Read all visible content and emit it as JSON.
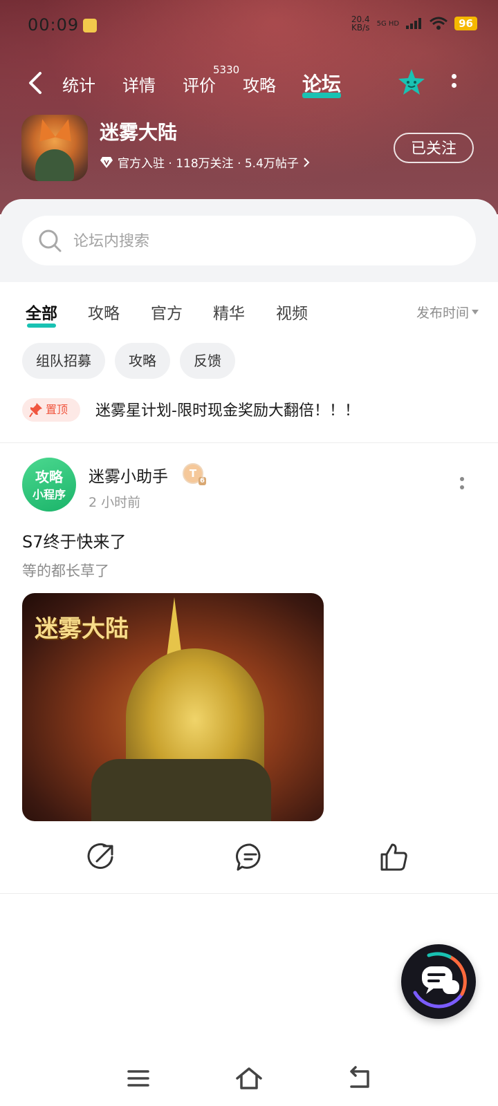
{
  "status_bar": {
    "time": "00:09",
    "net_speed_value": "20.4",
    "net_speed_unit": "KB/s",
    "network_label": "5G HD",
    "battery": "96"
  },
  "top_nav": {
    "tabs": [
      "统计",
      "详情",
      "评价",
      "攻略",
      "论坛"
    ],
    "active_tab": "论坛",
    "review_count": "5330"
  },
  "game": {
    "title": "迷雾大陆",
    "meta": "官方入驻 · 118万关注 · 5.4万帖子",
    "follow_label": "已关注"
  },
  "search": {
    "placeholder": "论坛内搜索"
  },
  "filters": {
    "tabs": [
      "全部",
      "攻略",
      "官方",
      "精华",
      "视频"
    ],
    "active": "全部",
    "sort_label": "发布时间"
  },
  "chips": [
    "组队招募",
    "攻略",
    "反馈"
  ],
  "pinned": {
    "badge": "置顶",
    "title": "迷雾星计划-限时现金奖励大翻倍！！！"
  },
  "post": {
    "avatar_line1": "攻略",
    "avatar_line2": "小程序",
    "author": "迷雾小助手",
    "badge_letter": "T",
    "badge_level": "6",
    "time": "2 小时前",
    "title": "S7终于快来了",
    "body": "等的都长草了",
    "image_watermark": "迷雾大陆"
  },
  "colors": {
    "accent": "#19c2b3",
    "pin": "#f0563f",
    "hero_bg": "#7c3d45"
  }
}
